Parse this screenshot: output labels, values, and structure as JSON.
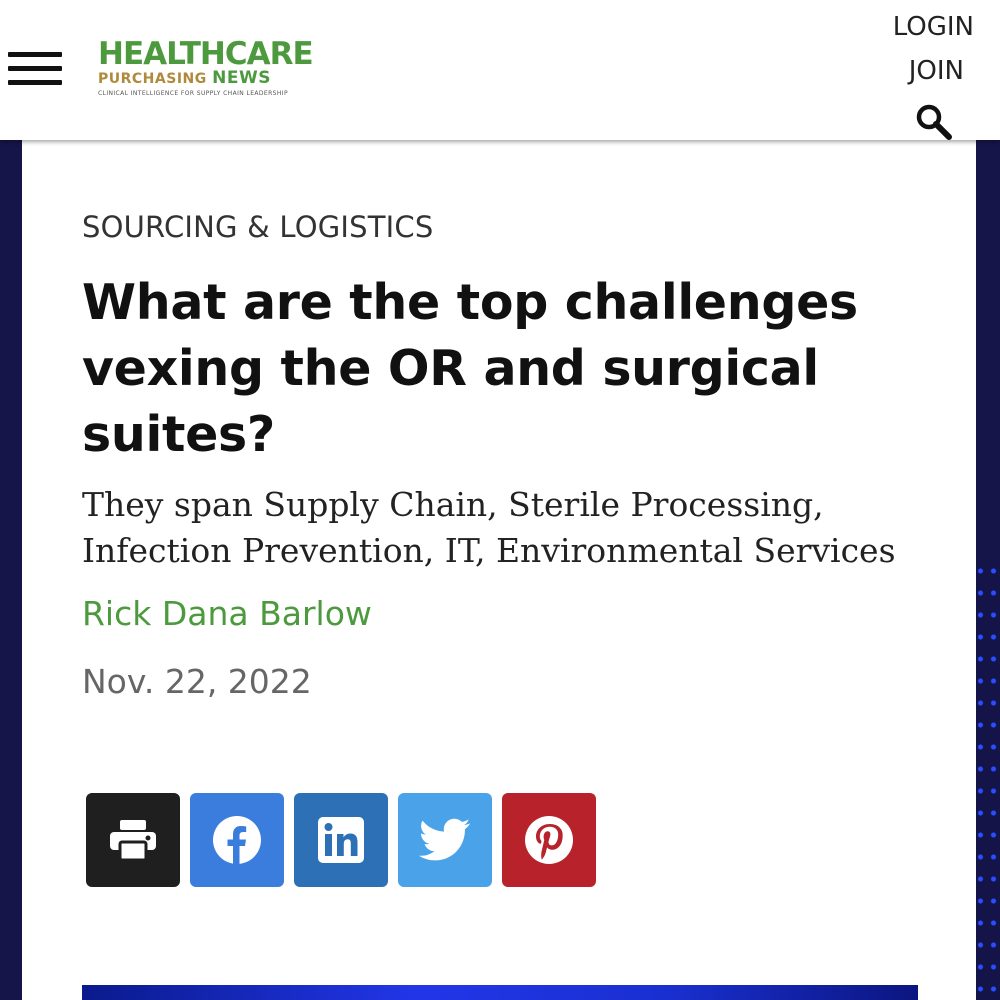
{
  "header": {
    "logo": {
      "line1": "HEALTHCARE",
      "line2_a": "PURCHASING ",
      "line2_b": "NEWS",
      "tagline": "CLINICAL INTELLIGENCE FOR SUPPLY CHAIN LEADERSHIP"
    },
    "login_label": "LOGIN",
    "join_label": "JOIN",
    "menu_icon": "hamburger-menu-icon",
    "search_icon": "search-icon"
  },
  "article": {
    "category": "SOURCING & LOGISTICS",
    "title": "What are the top challenges vexing the OR and surgical suites?",
    "subtitle": "They span Supply Chain, Sterile Processing, Infection Prevention, IT, Environmental Services",
    "author": "Rick Dana Barlow",
    "date": "Nov. 22, 2022"
  },
  "share_buttons": [
    {
      "name": "print",
      "icon": "print-icon",
      "color": "#1f1f1f"
    },
    {
      "name": "facebook",
      "icon": "facebook-icon",
      "color": "#3b7ddd"
    },
    {
      "name": "linkedin",
      "icon": "linkedin-icon",
      "color": "#2d70b6"
    },
    {
      "name": "twitter",
      "icon": "twitter-icon",
      "color": "#4aa3e9"
    },
    {
      "name": "pinterest",
      "icon": "pinterest-icon",
      "color": "#b8222a"
    }
  ],
  "colors": {
    "brand_green": "#4d9a3e",
    "brand_gold": "#b08a3a",
    "page_background": "#16154a"
  }
}
